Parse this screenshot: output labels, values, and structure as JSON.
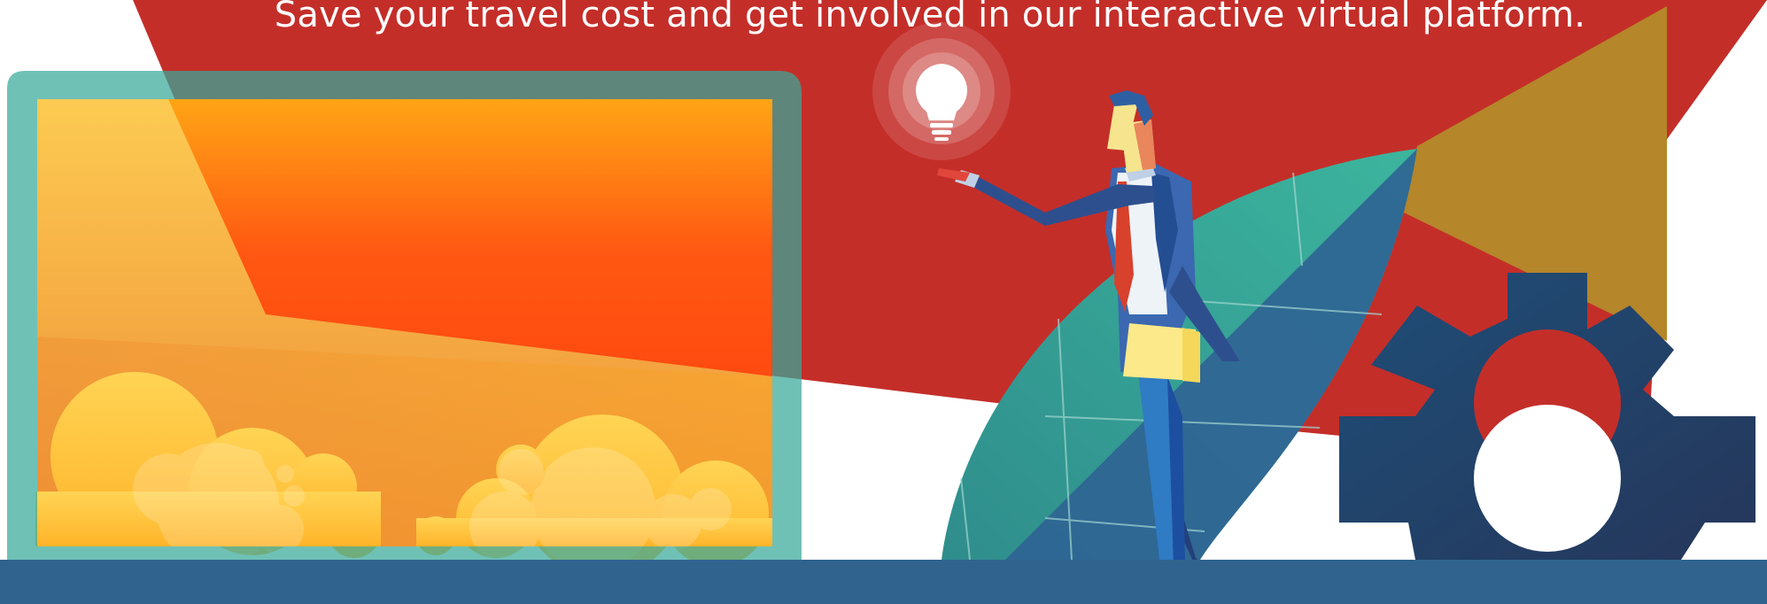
{
  "hero": {
    "tagline": "Save your travel cost and get involved in our interactive virtual platform."
  },
  "colors": {
    "red_band": "#C42E29",
    "gold_banner": "#B5862A",
    "teal_frame": "#37A99A",
    "screen_orange": "#F28A2E",
    "navy_footer": "#30648E",
    "gear_navy": "#253A5E",
    "leaf_teal": "#37A99A",
    "suit_blue": "#3B68B0"
  },
  "icons": [
    "lightbulb-icon",
    "gear-icon",
    "cloud-icon",
    "leaf-icon"
  ]
}
